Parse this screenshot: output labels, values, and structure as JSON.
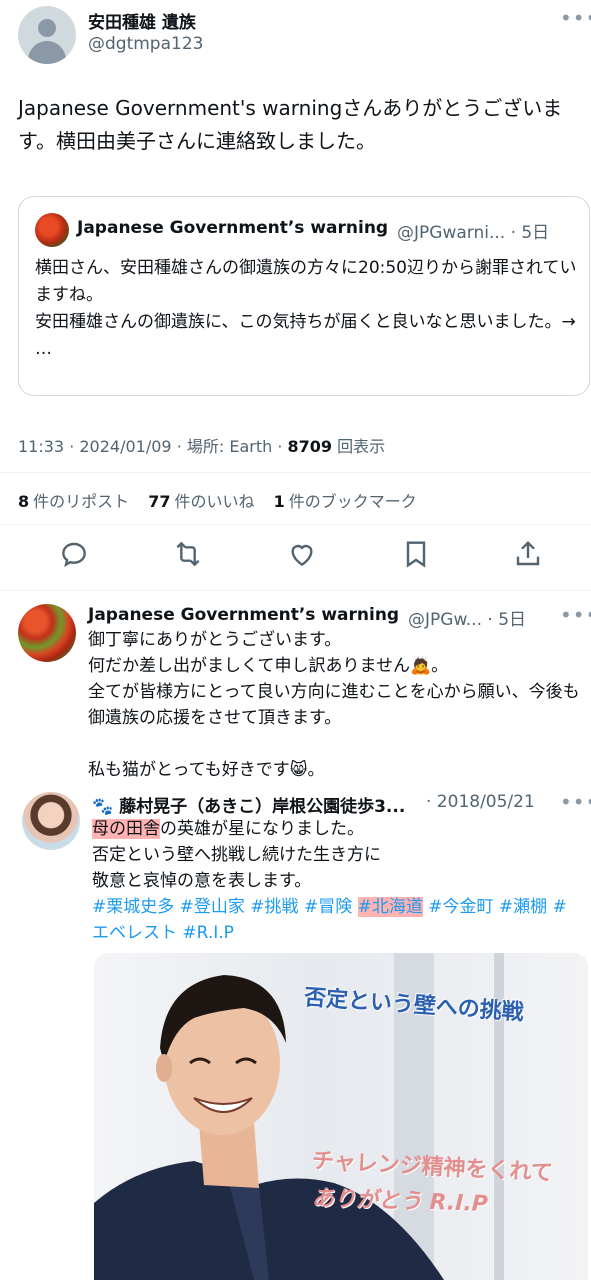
{
  "post": {
    "author_name": "安田種雄 遺族",
    "author_handle": "@dgtmpa123",
    "text": "Japanese Government's warningさんありがとうございます。横田由美子さんに連絡致しました。",
    "quote": {
      "name": "Japanese Government’s warning",
      "handle_time": "@JPGwarni... · 5日",
      "text_lines": [
        "横田さん、安田種雄さんの御遺族の方々に20:50辺りから謝罪されていますね。",
        "安田種雄さんの御遺族に、この気持ちが届くと良いなと思いました。→",
        "…"
      ]
    },
    "meta": {
      "time_date": "11:33 · 2024/01/09",
      "location": "場所: Earth",
      "sep": "·",
      "views_count": "8709",
      "views_label": "回表示"
    },
    "stats": {
      "reposts_count": "8",
      "reposts_label": "件のリポスト",
      "likes_count": "77",
      "likes_label": "件のいいね",
      "bookmarks_count": "1",
      "bookmarks_label": "件のブックマーク"
    }
  },
  "reply": {
    "name": "Japanese Government’s warning",
    "handle_time": "@JPGw... · 5日",
    "text_lines": [
      "御丁寧にありがとうございます。",
      "何だか差し出がましくて申し訳ありません🙇。",
      "全てが皆様方にとって良い方向に進むことを心から願い、今後も御遺族の応援をさせて頂きます。",
      "",
      "私も猫がとっても好きです😸。"
    ]
  },
  "nested": {
    "name": "🐾 藤村晃子（あきこ）岸根公園徒歩3...",
    "date": "· 2018/05/21",
    "line1_hl": "母の田舎",
    "line1_rest": "の英雄が星になりました。",
    "line2": "否定という壁へ挑戦し続けた生き方に",
    "line3": "敬意と哀悼の意を表します。",
    "tags_a": "#栗城史多 #登山家 #挑戦 #冒険 ",
    "tag_hl": "#北海道",
    "tags_b": " #今金町 #瀬棚 #エベレスト #R.I.P",
    "photo_texts": {
      "top": "否定という壁への挑戦",
      "mid": "チャレンジ精神をくれて",
      "bottom": "ありがとう R.I.P"
    }
  },
  "icons": [
    "reply-icon",
    "repost-icon",
    "like-icon",
    "bookmark-icon",
    "share-icon",
    "more-icon"
  ],
  "colors": {
    "link": "#1d9bf0",
    "secondary_text": "#536471",
    "highlight": "#ffb3b3"
  }
}
